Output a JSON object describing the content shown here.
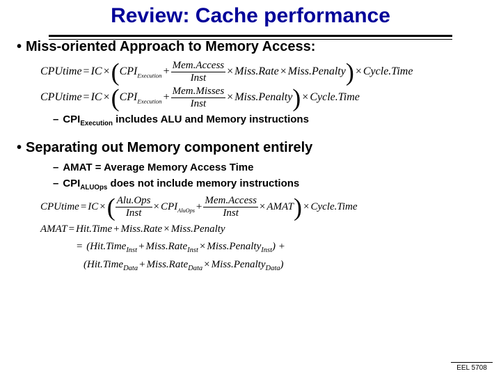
{
  "title": "Review: Cache performance",
  "bullets": {
    "b1": "Miss-oriented Approach to Memory Access:",
    "b2": "Separating out Memory component entirely"
  },
  "eq1": {
    "lhs": "CPUtime",
    "ic": "IC",
    "cpi_exec": "CPI",
    "cpi_exec_sub": "Execution",
    "memaccess": "Mem.Access",
    "inst": "Inst",
    "missrate": "Miss.Rate",
    "misspenalty": "Miss.Penalty",
    "cycletime": "Cycle.Time"
  },
  "eq2": {
    "memmisses": "Mem.Misses"
  },
  "sub1": {
    "cpi": "CPI",
    "cpi_sub": "Execution",
    "text": " includes ALU and Memory instructions"
  },
  "sub2a": "AMAT = Average Memory Access Time",
  "sub2b": {
    "cpi": "CPI",
    "cpi_sub": "ALUOps",
    "text": " does not include memory instructions"
  },
  "eq3": {
    "aluops": "Alu.Ops",
    "cpi_aluops": "CPI",
    "cpi_aluops_sub": "AluOps",
    "memaccess": "Mem.Access",
    "amat": "AMAT"
  },
  "amat": {
    "lhs": "AMAT",
    "hittime": "Hit.Time",
    "missrate": "Miss.Rate",
    "misspenalty": "Miss.Penalty",
    "hittime_inst": "Hit.Time",
    "missrate_inst": "Miss.Rate",
    "misspenalty_inst": "Miss.Penalty",
    "hittime_data": "Hit.Time",
    "missrate_data": "Miss.Rate",
    "misspenalty_data": "Miss.Penalty",
    "sub_inst": "Inst",
    "sub_data": "Data"
  },
  "footer": "EEL 5708"
}
